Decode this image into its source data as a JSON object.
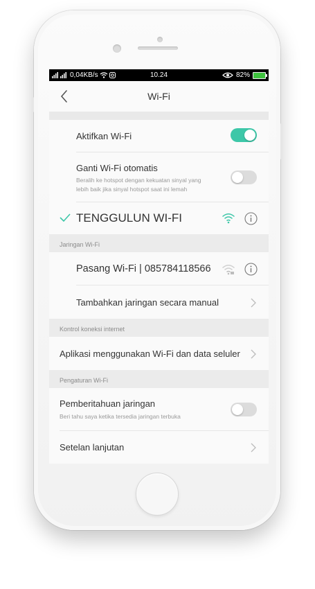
{
  "status_bar": {
    "data_rate": "0,04KB/s",
    "time": "10.24",
    "battery_percent": "82%"
  },
  "nav": {
    "title": "Wi-Fi"
  },
  "wifi_toggle": {
    "label": "Aktifkan Wi-Fi",
    "enabled": true
  },
  "auto_switch": {
    "label": "Ganti Wi-Fi otomatis",
    "description_line1": "Beralih ke hotspot dengan kekuatan sinyal yang",
    "description_line2": "lebih baik jika sinyal hotspot saat ini lemah",
    "enabled": false
  },
  "connected_network": {
    "name": "TENGGULUN WI-FI"
  },
  "available_networks": {
    "section_label": "Jaringan Wi-Fi",
    "items": [
      {
        "name": "Pasang Wi-Fi | 085784118566"
      }
    ],
    "add_manual_label": "Tambahkan jaringan secara manual"
  },
  "internet_control": {
    "section_label": "Kontrol koneksi internet",
    "apps_label": "Aplikasi menggunakan Wi-Fi dan data seluler"
  },
  "wifi_settings": {
    "section_label": "Pengaturan Wi-Fi",
    "notification_label": "Pemberitahuan jaringan",
    "notification_desc": "Beri tahu saya ketika tersedia jaringan terbuka",
    "notification_enabled": false,
    "advanced_label": "Setelan lanjutan"
  },
  "colors": {
    "accent": "#3dc7a8",
    "toggle_off": "#dcdcdc",
    "battery": "#3ec23e"
  }
}
